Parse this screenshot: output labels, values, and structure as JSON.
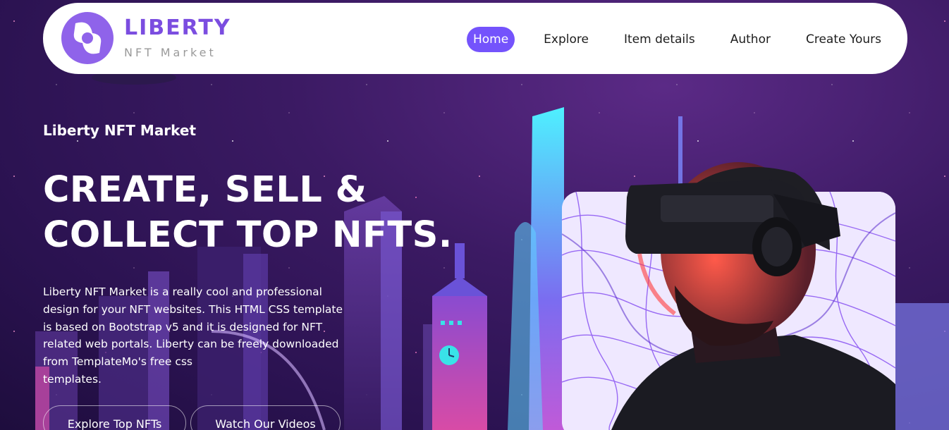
{
  "brand": {
    "title": "LIBERTY",
    "subtitle": "NFT Market"
  },
  "nav": {
    "items": [
      {
        "label": "Home",
        "active": true
      },
      {
        "label": "Explore",
        "active": false
      },
      {
        "label": "Item details",
        "active": false
      },
      {
        "label": "Author",
        "active": false
      },
      {
        "label": "Create Yours",
        "active": false
      }
    ]
  },
  "hero": {
    "eyebrow": "Liberty NFT Market",
    "headline_line1": "CREATE, SELL &",
    "headline_line2": "COLLECT TOP NFTS.",
    "description": [
      "Liberty NFT Market is a really cool and professional",
      "design for your NFT websites. This HTML CSS template",
      "is based on Bootstrap v5 and it is designed for NFT",
      "related web portals. Liberty can be freely downloaded",
      "from TemplateMo's free css",
      "templates."
    ],
    "buttons": {
      "explore": "Explore Top NFTs",
      "watch": "Watch Our Videos"
    }
  },
  "colors": {
    "accent": "#7453fc",
    "brand": "#7b4de0",
    "background": "#3b1a63",
    "nav_bg": "#ffffff",
    "text_light": "#ffffff"
  },
  "icons": {
    "logo": "liberty-logo-icon"
  }
}
